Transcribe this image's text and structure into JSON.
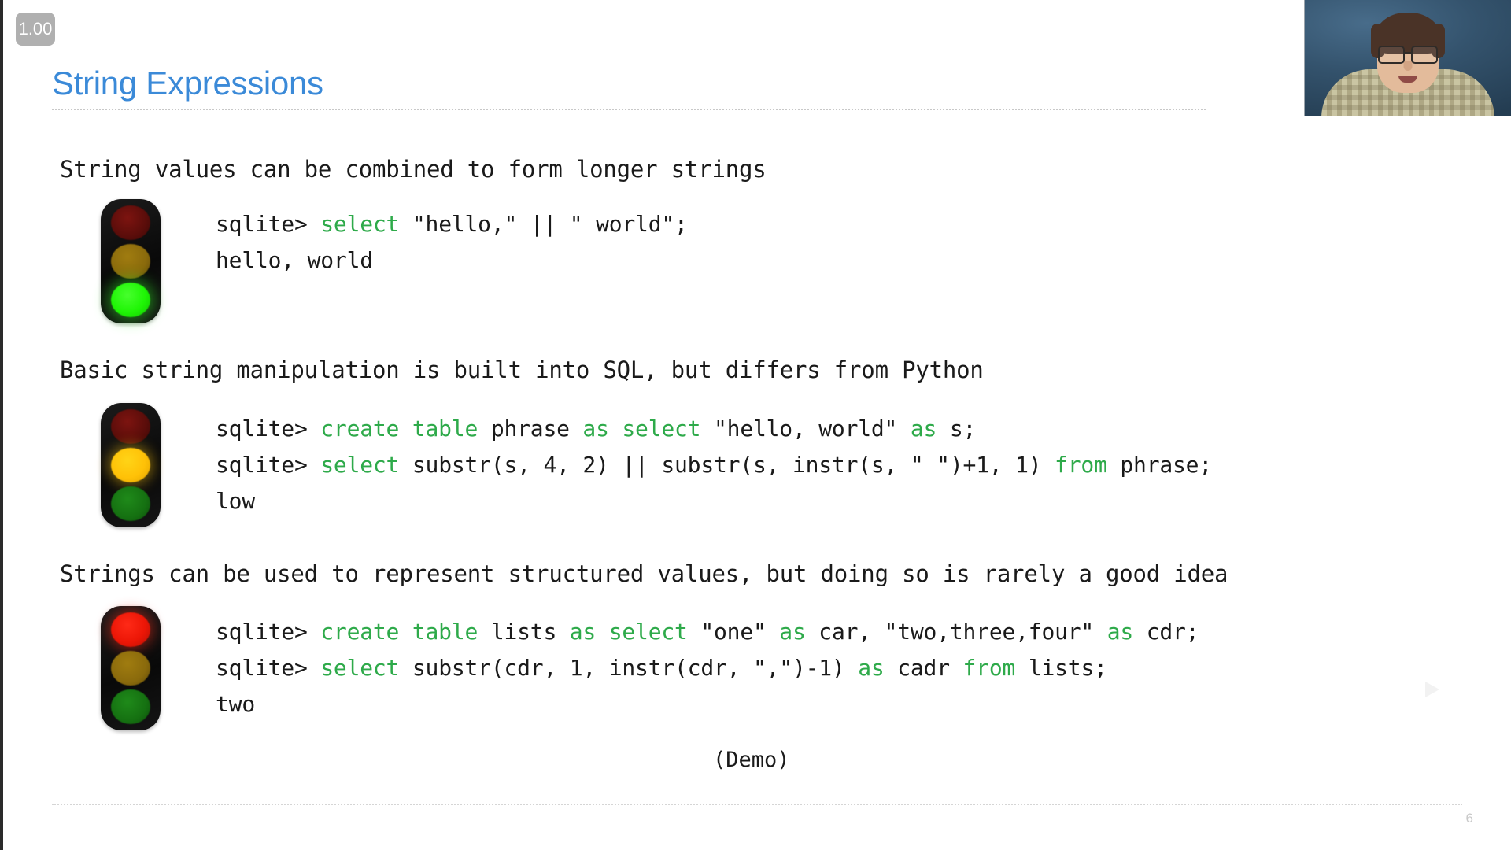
{
  "player": {
    "speed_badge": "1.00",
    "watermark_icon": "tv-play-logo-watermark"
  },
  "slide": {
    "title": "String Expressions",
    "page_number": "6",
    "demo_label": "(Demo)",
    "accent_color": "#3b8ad8",
    "keyword_color": "#2eaa4a",
    "text_color": "#1a1a1a",
    "sections": [
      {
        "heading": "String values can be combined to form longer strings",
        "traffic_light": "green",
        "code": [
          [
            {
              "t": "sqlite> ",
              "kw": false
            },
            {
              "t": "select",
              "kw": true
            },
            {
              "t": " \"hello,\" || \" world\";",
              "kw": false
            }
          ],
          [
            {
              "t": "hello, world",
              "kw": false
            }
          ]
        ]
      },
      {
        "heading": "Basic string manipulation is built into SQL, but differs from Python",
        "traffic_light": "amber",
        "code": [
          [
            {
              "t": "sqlite> ",
              "kw": false
            },
            {
              "t": "create table",
              "kw": true
            },
            {
              "t": " phrase ",
              "kw": false
            },
            {
              "t": "as select",
              "kw": true
            },
            {
              "t": " \"hello, world\" ",
              "kw": false
            },
            {
              "t": "as",
              "kw": true
            },
            {
              "t": " s;",
              "kw": false
            }
          ],
          [
            {
              "t": "sqlite> ",
              "kw": false
            },
            {
              "t": "select",
              "kw": true
            },
            {
              "t": " substr(s, 4, 2) || substr(s, instr(s, \" \")+1, 1) ",
              "kw": false
            },
            {
              "t": "from",
              "kw": true
            },
            {
              "t": " phrase;",
              "kw": false
            }
          ],
          [
            {
              "t": "low",
              "kw": false
            }
          ]
        ]
      },
      {
        "heading": "Strings can be used to represent structured values, but doing so is rarely a good idea",
        "traffic_light": "red",
        "code": [
          [
            {
              "t": "sqlite> ",
              "kw": false
            },
            {
              "t": "create table",
              "kw": true
            },
            {
              "t": " lists ",
              "kw": false
            },
            {
              "t": "as select",
              "kw": true
            },
            {
              "t": " \"one\" ",
              "kw": false
            },
            {
              "t": "as",
              "kw": true
            },
            {
              "t": " car, \"two,three,four\" ",
              "kw": false
            },
            {
              "t": "as",
              "kw": true
            },
            {
              "t": " cdr;",
              "kw": false
            }
          ],
          [
            {
              "t": "sqlite> ",
              "kw": false
            },
            {
              "t": "select",
              "kw": true
            },
            {
              "t": " substr(cdr, 1, instr(cdr, \",\")-1) ",
              "kw": false
            },
            {
              "t": "as",
              "kw": true
            },
            {
              "t": " cadr ",
              "kw": false
            },
            {
              "t": "from",
              "kw": true
            },
            {
              "t": " lists;",
              "kw": false
            }
          ],
          [
            {
              "t": "two",
              "kw": false
            }
          ]
        ]
      }
    ]
  }
}
